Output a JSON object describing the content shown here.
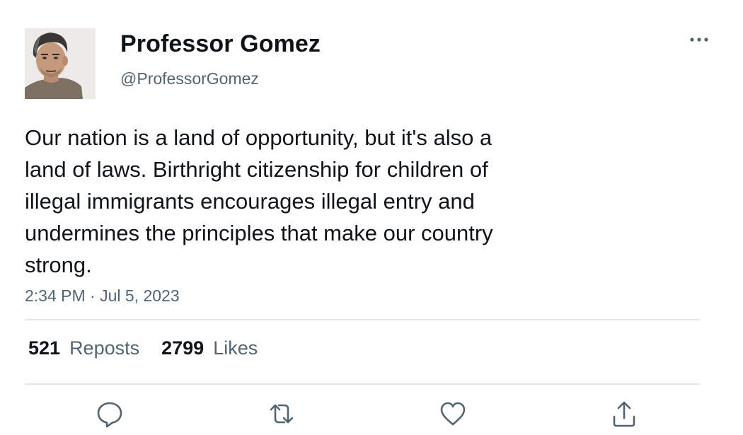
{
  "tweet": {
    "author": {
      "display_name": "Professor Gomez",
      "handle": "@ProfessorGomez",
      "avatar": "portrait-photo"
    },
    "text_lines": [
      "Our nation is a land of opportunity, but it's also a",
      "land of laws. Birthright citizenship for children of",
      "illegal immigrants encourages illegal entry and",
      "undermines the principles that make our country",
      "strong."
    ],
    "timestamp": "2:34 PM · Jul 5, 2023",
    "stats": {
      "reposts_count": "521",
      "reposts_label": "Reposts",
      "likes_count": "2799",
      "likes_label": "Likes"
    },
    "actions": [
      "reply-icon",
      "repost-icon",
      "like-icon",
      "share-icon"
    ],
    "menu_icon": "more-options-icon"
  },
  "colors": {
    "text_primary": "#0f1419",
    "text_secondary": "#536471",
    "divider": "#e4e6e8",
    "background": "#ffffff"
  }
}
